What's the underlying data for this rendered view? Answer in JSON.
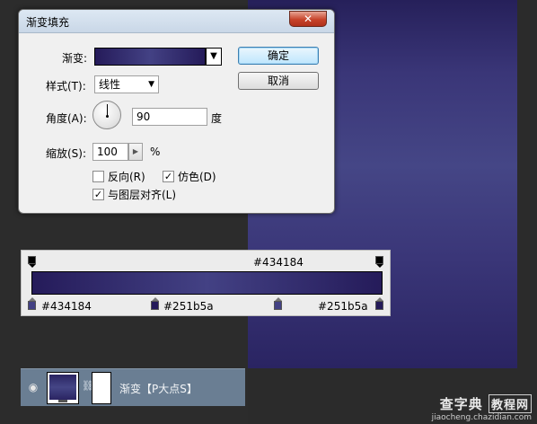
{
  "dialog": {
    "title": "渐变填充",
    "close_label": "✕",
    "gradient_label": "渐变:",
    "style_label": "样式(T):",
    "style_value": "线性",
    "angle_label": "角度(A):",
    "angle_value": "90",
    "angle_unit": "度",
    "scale_label": "缩放(S):",
    "scale_value": "100",
    "scale_unit": "%",
    "reverse_label": "反向(R)",
    "reverse_checked": false,
    "dither_label": "仿色(D)",
    "dither_checked": true,
    "align_label": "与图层对齐(L)",
    "align_checked": true,
    "ok_label": "确定",
    "cancel_label": "取消"
  },
  "gradient_editor": {
    "top_stop_label": "#434184",
    "bottom_stops": [
      "#434184",
      "#251b5a",
      "#251b5a"
    ],
    "colors": {
      "dark": "#251b5a",
      "light": "#434184"
    }
  },
  "layer": {
    "name": "渐变【P大点S】",
    "chain_icon": "⛓",
    "eye_icon": "👁"
  },
  "watermark": {
    "line1_a": "查字典",
    "line1_b": "教程网",
    "line2": "jiaocheng.chazidian.com"
  }
}
